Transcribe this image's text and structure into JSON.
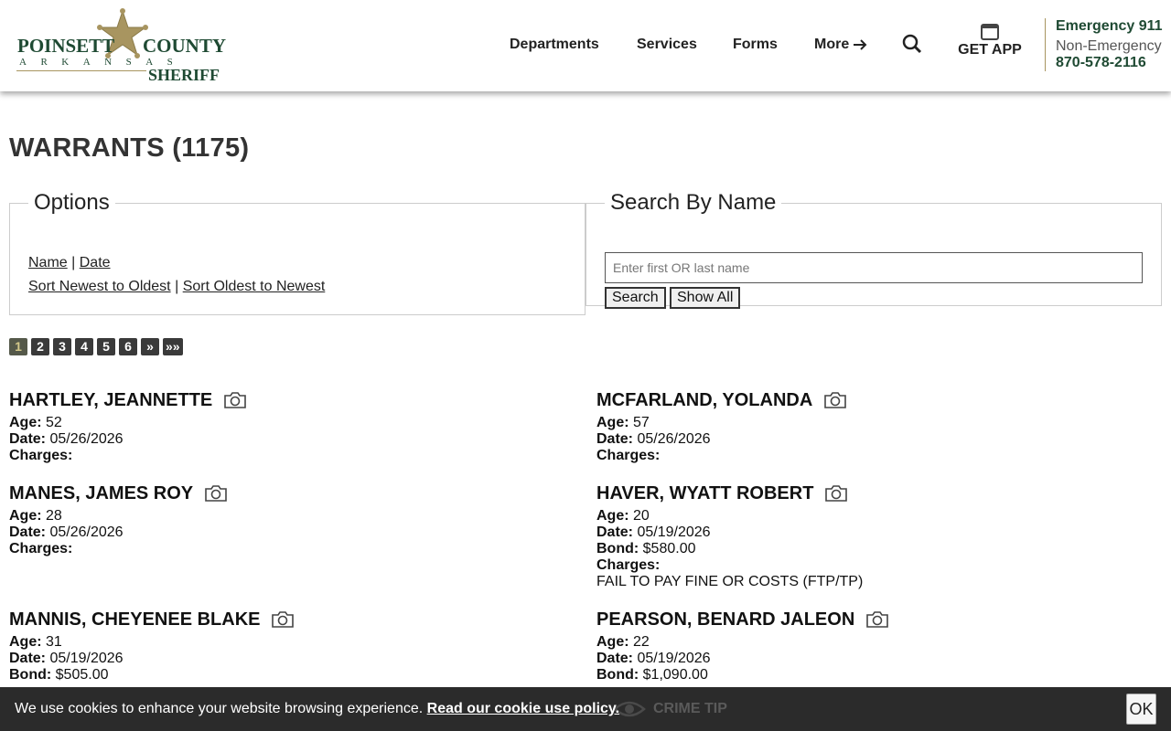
{
  "logo": {
    "line1_left": "POINSETT",
    "line1_right": "COUNTY",
    "line2": "ARKANSAS",
    "line3": "SHERIFF"
  },
  "nav": {
    "departments": "Departments",
    "services": "Services",
    "forms": "Forms",
    "more": "More"
  },
  "app": {
    "label": "GET APP"
  },
  "contact": {
    "emergency": "Emergency 911",
    "non_emergency": "Non-Emergency",
    "phone": "870-578-2116"
  },
  "page": {
    "title": "WARRANTS (1175)"
  },
  "options": {
    "legend": "Options",
    "sort_name": "Name",
    "sort_date": "Date",
    "sep": "|",
    "newest": "Sort Newest to Oldest",
    "oldest": "Sort Oldest to Newest"
  },
  "search": {
    "legend": "Search By Name",
    "placeholder": "Enter first OR last name",
    "search_label": "Search",
    "show_all_label": "Show All"
  },
  "pager": [
    "1",
    "2",
    "3",
    "4",
    "5",
    "6",
    "»",
    "»»"
  ],
  "labels": {
    "age": "Age:",
    "date": "Date:",
    "bond": "Bond:",
    "charges": "Charges:"
  },
  "records": [
    {
      "name": "HARTLEY, JEANNETTE",
      "age": "52",
      "date": "05/26/2026",
      "bond": "",
      "charges": ""
    },
    {
      "name": "MCFARLAND, YOLANDA",
      "age": "57",
      "date": "05/26/2026",
      "bond": "",
      "charges": ""
    },
    {
      "name": "MANES, JAMES ROY",
      "age": "28",
      "date": "05/26/2026",
      "bond": "",
      "charges": ""
    },
    {
      "name": "HAVER, WYATT ROBERT",
      "age": "20",
      "date": "05/19/2026",
      "bond": "$580.00",
      "charges": "FAIL TO PAY FINE OR COSTS (FTP/TP)"
    },
    {
      "name": "MANNIS, CHEYENEE BLAKE",
      "age": "31",
      "date": "05/19/2026",
      "bond": "$505.00",
      "charges": ""
    },
    {
      "name": "PEARSON, BENARD JALEON",
      "age": "22",
      "date": "05/19/2026",
      "bond": "$1,090.00",
      "charges": ""
    }
  ],
  "cookie": {
    "text": "We use cookies to enhance your website browsing experience.",
    "link": "Read our cookie use policy.",
    "crime_tip": "CRIME TIP",
    "ok": "OK"
  },
  "colors": {
    "brand_green": "#1f4a33",
    "gold": "#a89560",
    "cookie_bg": "#2b2b2b"
  }
}
